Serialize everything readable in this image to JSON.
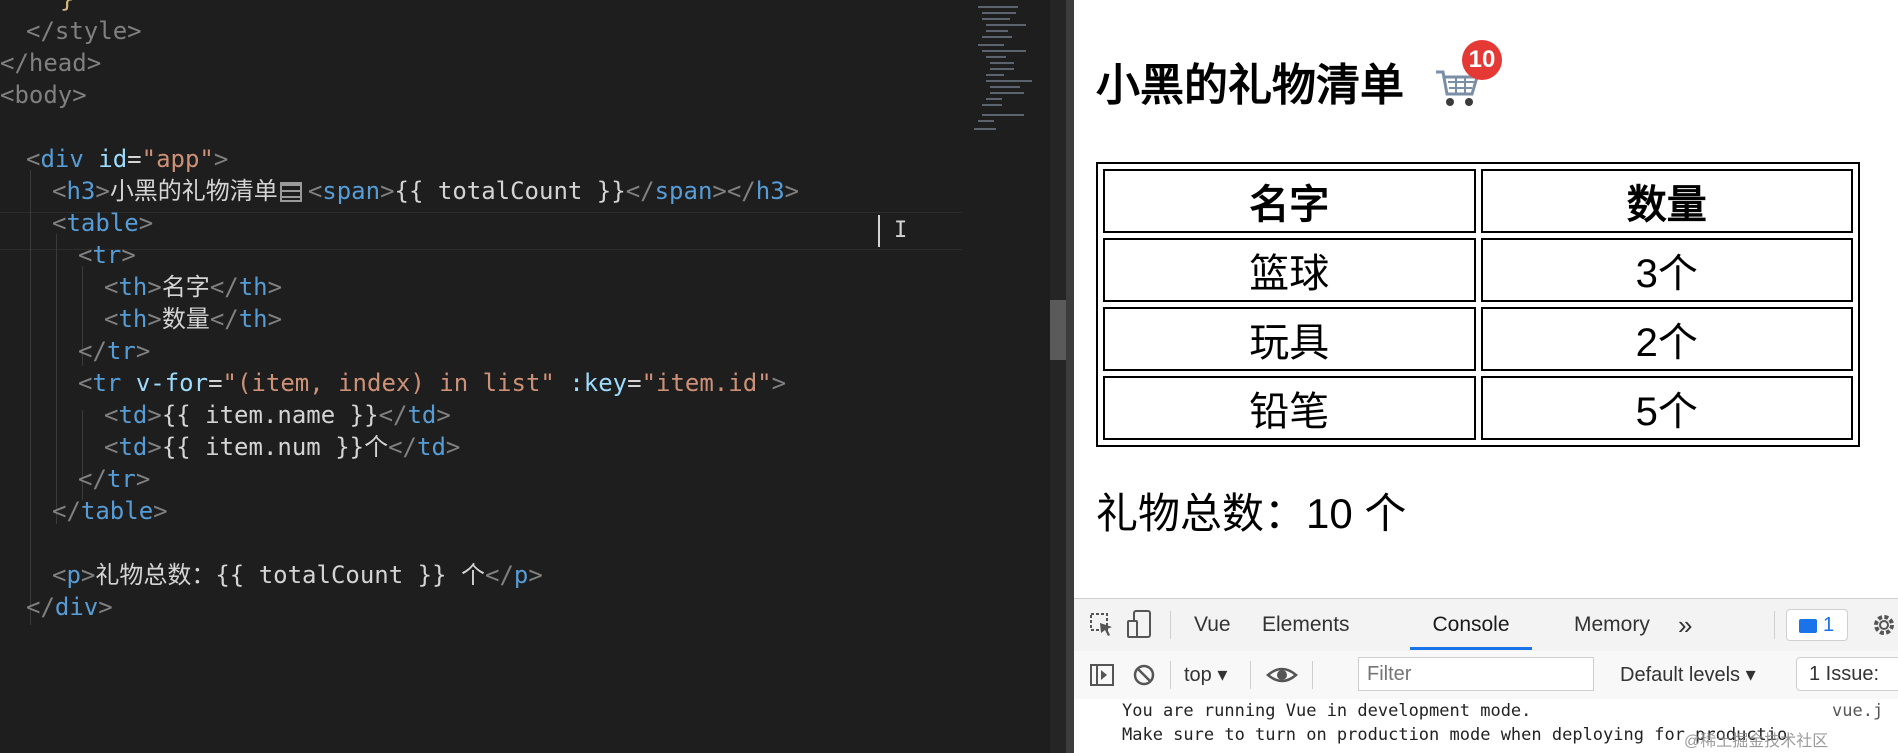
{
  "editor": {
    "lines": {
      "l0": {
        "brace": "}"
      },
      "l1": {
        "close_style": "</style>"
      },
      "l2": {
        "close_head": "</head>"
      },
      "l3": {
        "open_body": "<body>"
      },
      "l5": {
        "open": "<",
        "tag": "div",
        "attr": "id",
        "eq": "=",
        "val": "\"app\"",
        "close": ">"
      },
      "l6": {
        "open": "<",
        "tag": "h3",
        "close": ">",
        "text": "小黑的礼物清单",
        "span_open": "<",
        "span_tag": "span",
        "span_close": ">",
        "mustache": "{{ totalCount }}",
        "span_end_open": "</",
        "span_end_tag": "span",
        "span_end_close": ">",
        "h3_end_open": "</",
        "h3_end_tag": "h3",
        "h3_end_close": ">"
      },
      "l7": {
        "open": "<",
        "tag": "table",
        "close": ">"
      },
      "l8": {
        "open": "<",
        "tag": "tr",
        "close": ">"
      },
      "l9": {
        "open": "<",
        "tag": "th",
        "close": ">",
        "text": "名字",
        "end_open": "</",
        "end_tag": "th",
        "end_close": ">"
      },
      "l10": {
        "open": "<",
        "tag": "th",
        "close": ">",
        "text": "数量",
        "end_open": "</",
        "end_tag": "th",
        "end_close": ">"
      },
      "l11": {
        "open": "</",
        "tag": "tr",
        "close": ">"
      },
      "l12": {
        "open": "<",
        "tag": "tr",
        "directive": "v-for",
        "eq": "=",
        "dval": "\"(item, index) in list\"",
        "key": ":key",
        "eq2": "=",
        "kval": "\"item.id\"",
        "close": ">"
      },
      "l13": {
        "open": "<",
        "tag": "td",
        "close": ">",
        "text": "{{ item.name }}",
        "end_open": "</",
        "end_tag": "td",
        "end_close": ">"
      },
      "l14": {
        "open": "<",
        "tag": "td",
        "close": ">",
        "text": "{{ item.num }}个",
        "end_open": "</",
        "end_tag": "td",
        "end_close": ">"
      },
      "l15": {
        "open": "</",
        "tag": "tr",
        "close": ">"
      },
      "l16": {
        "open": "</",
        "tag": "table",
        "close": ">"
      },
      "l18": {
        "open": "<",
        "tag": "p",
        "close": ">",
        "text": "礼物总数：{{ totalCount }} 个",
        "end_open": "</",
        "end_tag": "p",
        "end_close": ">"
      },
      "l19": {
        "open": "</",
        "tag": "div",
        "close": ">"
      }
    },
    "ibeam": "I"
  },
  "page": {
    "heading": "小黑的礼物清单",
    "badge_count": "10",
    "table": {
      "headers": [
        "名字",
        "数量"
      ],
      "rows": [
        [
          "篮球",
          "3个"
        ],
        [
          "玩具",
          "2个"
        ],
        [
          "铅笔",
          "5个"
        ]
      ]
    },
    "total": "礼物总数：10 个"
  },
  "devtools": {
    "tabs": [
      "Vue",
      "Elements",
      "Console",
      "Memory"
    ],
    "active_tab": "Console",
    "more_tabs": "»",
    "message_count": "1",
    "context": "top",
    "filter_placeholder": "Filter",
    "levels": "Default levels",
    "issues": "1 Issue:",
    "console_lines": [
      "You are running Vue in development mode.",
      "Make sure to turn on production mode when deploying for productio"
    ],
    "source_link": "vue.j",
    "watermark": "@稀土掘金技术社区"
  }
}
